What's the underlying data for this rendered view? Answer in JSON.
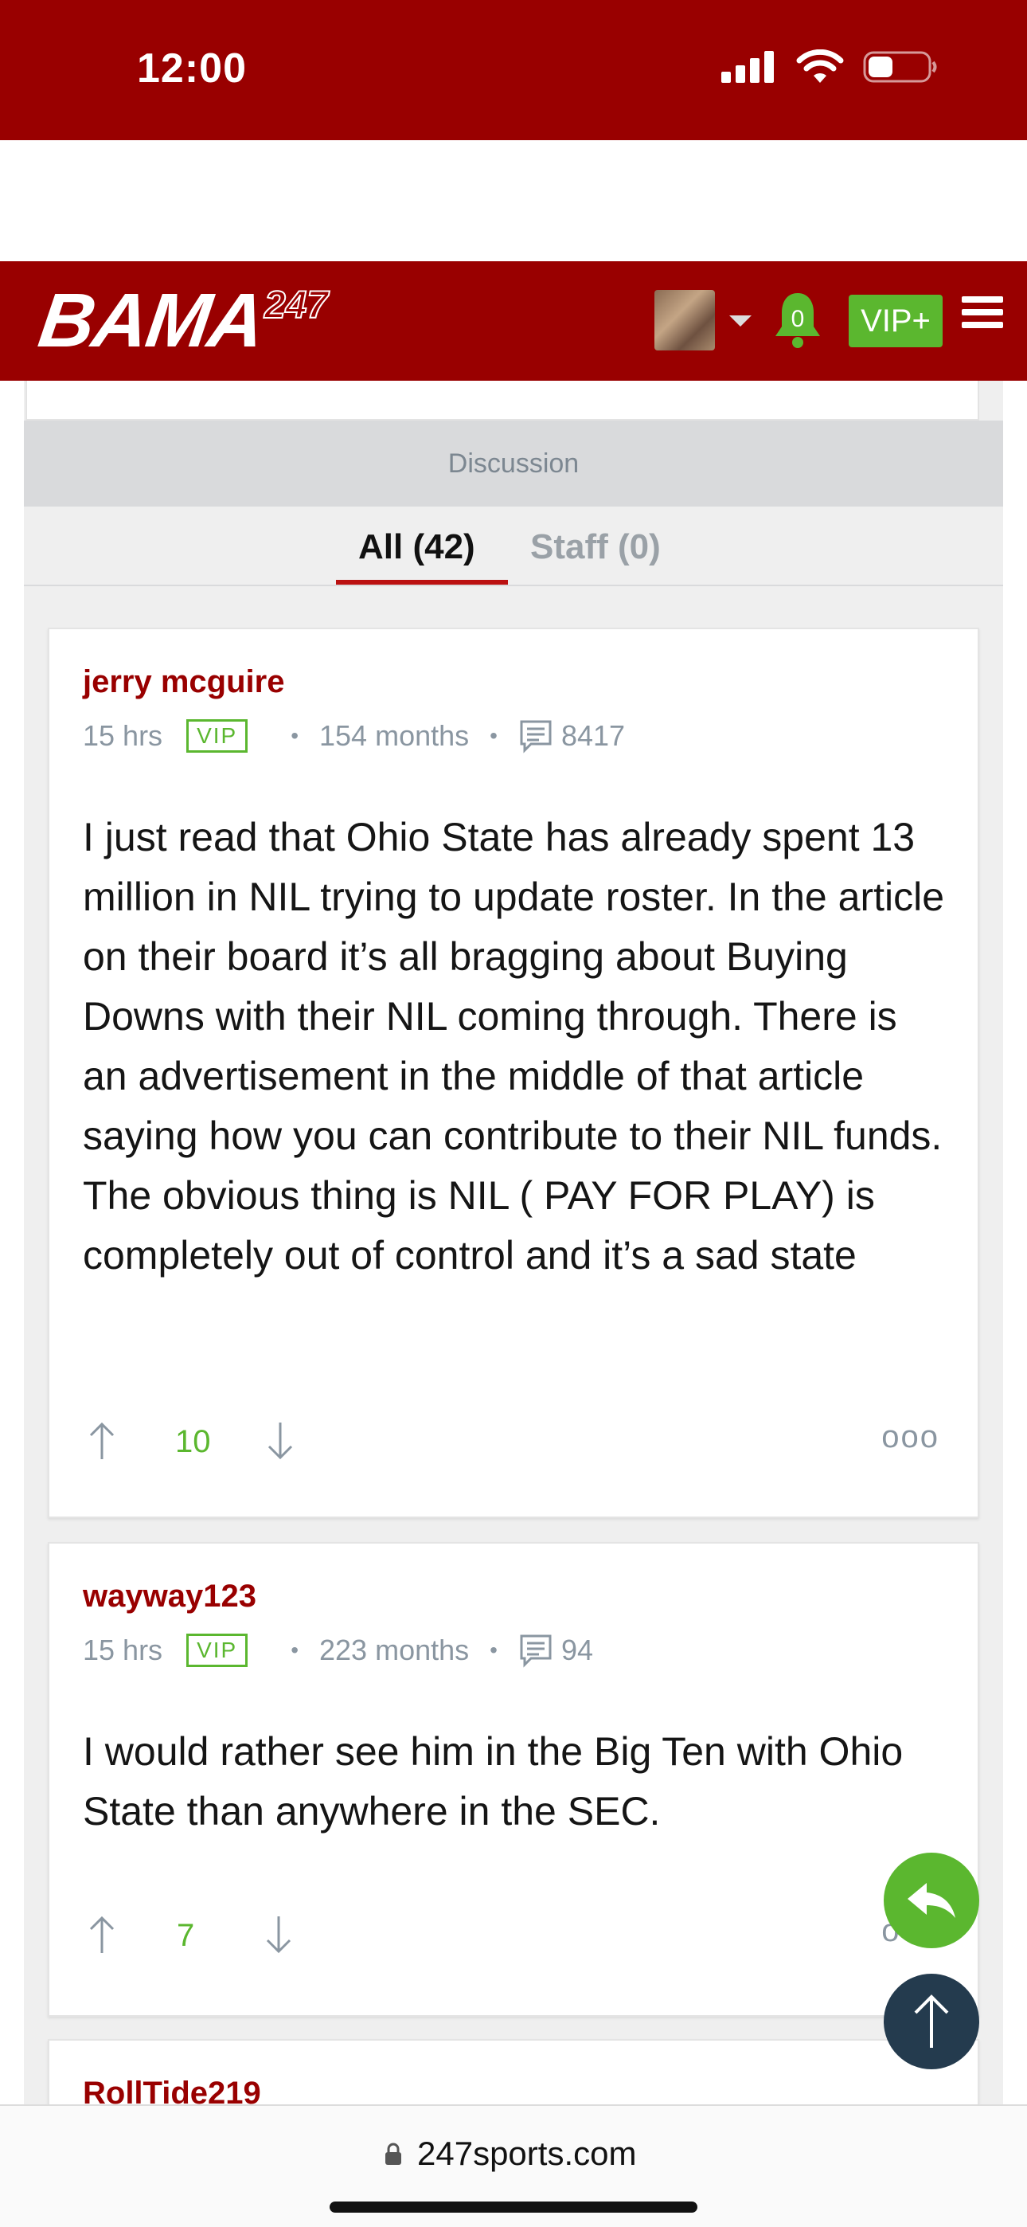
{
  "status_bar": {
    "time": "12:00"
  },
  "header": {
    "logo_main": "BAMA",
    "logo_sup": "247",
    "notification_count": "0",
    "vip_label": "VIP+"
  },
  "discussion": {
    "title": "Discussion",
    "tabs": [
      {
        "label": "All (42)",
        "active": true
      },
      {
        "label": "Staff (0)",
        "active": false
      }
    ]
  },
  "comments": [
    {
      "user": "jerry mcguire",
      "time": "15 hrs",
      "badge": "VIP",
      "tenure": "154 months",
      "posts": "8417",
      "body": "I just read that Ohio State has already spent 13 million in NIL trying to update roster. In the article on their board it’s all bragging about Buying Downs with their NIL coming through. There is an advertisement in the middle of that article saying how you can contribute to their NIL funds. The obvious thing is NIL ( PAY FOR PLAY) is completely out of control and it’s a sad state",
      "votes": "10",
      "more": "ooo"
    },
    {
      "user": "wayway123",
      "time": "15 hrs",
      "badge": "VIP",
      "tenure": "223 months",
      "posts": "94",
      "body": "I would rather see him in the Big Ten with Ohio State than anywhere in the SEC.",
      "votes": "7",
      "more": "ooo"
    },
    {
      "user": "RollTide219"
    }
  ],
  "browser": {
    "url": "247sports.com"
  },
  "colors": {
    "brand_red": "#990000",
    "vip_green": "#5bb72f",
    "navy": "#243b4e"
  }
}
